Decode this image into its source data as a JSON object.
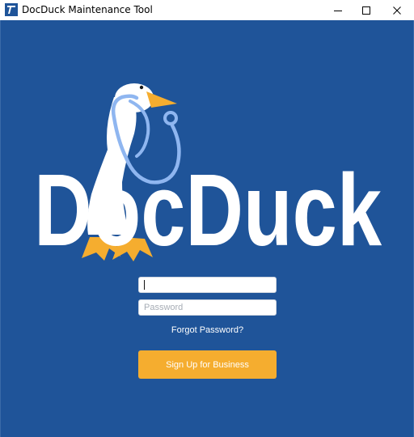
{
  "window": {
    "title": "DocDuck Maintenance Tool",
    "app_icon": "docduck-app-icon",
    "controls": {
      "minimize_icon": "minimize-icon",
      "maximize_icon": "maximize-icon",
      "close_icon": "close-icon"
    }
  },
  "brand": {
    "logo_text": "DocDuck",
    "background_color": "#1f5499",
    "accent_color": "#f5ad2f"
  },
  "login": {
    "username": {
      "value": "",
      "placeholder": ""
    },
    "password": {
      "value": "",
      "placeholder": "Password"
    },
    "forgot_label": "Forgot Password?",
    "signup_label": "Sign Up for Business"
  }
}
